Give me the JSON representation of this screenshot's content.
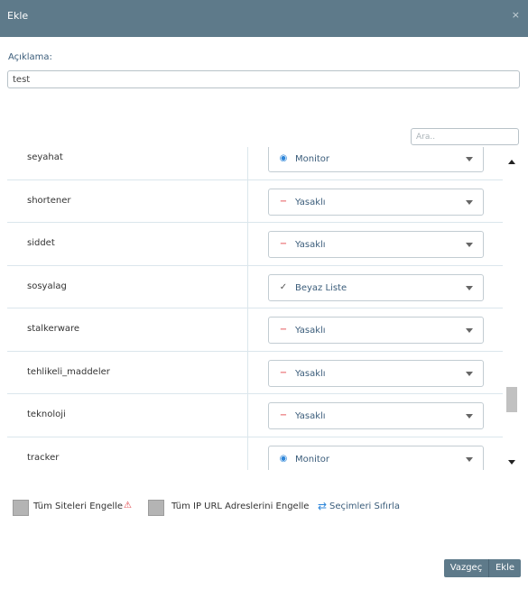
{
  "dialog": {
    "title": "Ekle",
    "close_glyph": "×"
  },
  "description": {
    "label": "Açıklama:",
    "value": "test"
  },
  "search": {
    "placeholder": "Ara.."
  },
  "rows": [
    {
      "category": "seyahat",
      "action": "Monitor",
      "icon": "eye-icon",
      "glyph": "◉",
      "color": "#2e86d9"
    },
    {
      "category": "shortener",
      "action": "Yasaklı",
      "icon": "minus-icon",
      "glyph": "−",
      "color": "#e0393e"
    },
    {
      "category": "siddet",
      "action": "Yasaklı",
      "icon": "minus-icon",
      "glyph": "−",
      "color": "#e0393e"
    },
    {
      "category": "sosyalag",
      "action": "Beyaz Liste",
      "icon": "check-icon",
      "glyph": "✓",
      "color": "#555555"
    },
    {
      "category": "stalkerware",
      "action": "Yasaklı",
      "icon": "minus-icon",
      "glyph": "−",
      "color": "#e0393e"
    },
    {
      "category": "tehlikeli_maddeler",
      "action": "Yasaklı",
      "icon": "minus-icon",
      "glyph": "−",
      "color": "#e0393e"
    },
    {
      "category": "teknoloji",
      "action": "Yasaklı",
      "icon": "minus-icon",
      "glyph": "−",
      "color": "#e0393e"
    },
    {
      "category": "tracker",
      "action": "Monitor",
      "icon": "eye-icon",
      "glyph": "◉",
      "color": "#2e86d9"
    }
  ],
  "options": {
    "block_all_sites": "Tüm Siteleri Engelle",
    "block_all_ip_urls": "Tüm IP URL Adreslerini Engelle",
    "reset_selections": "Seçimleri Sıfırla",
    "warning_glyph": "⚠",
    "reset_glyph": "⇄"
  },
  "buttons": {
    "cancel": "Vazgeç",
    "add": "Ekle"
  },
  "colors": {
    "header": "#5e7a8a",
    "accent": "#2e86d9",
    "danger": "#e0393e"
  }
}
